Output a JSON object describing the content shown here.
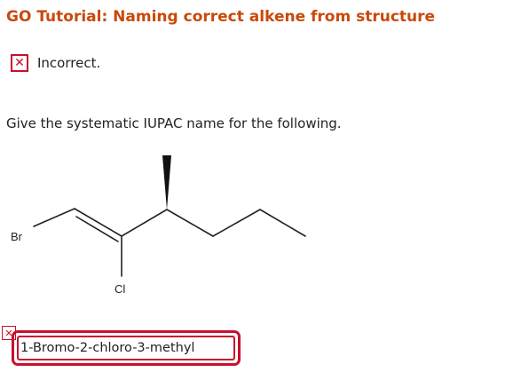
{
  "header": {
    "title": "GO Tutorial: Naming correct alkene from structure"
  },
  "status": {
    "icon": "x-mark-icon",
    "text": "Incorrect.",
    "color": "#c8102e"
  },
  "question": {
    "prompt": "Give the systematic IUPAC name for the following."
  },
  "structure": {
    "atoms": {
      "br": "Br",
      "cl": "Cl"
    }
  },
  "answer": {
    "value": "1-Bromo-2-chloro-3-methyl",
    "status_icon": "x-mark-icon"
  },
  "colors": {
    "title": "#c9490a",
    "error": "#c8102e"
  }
}
